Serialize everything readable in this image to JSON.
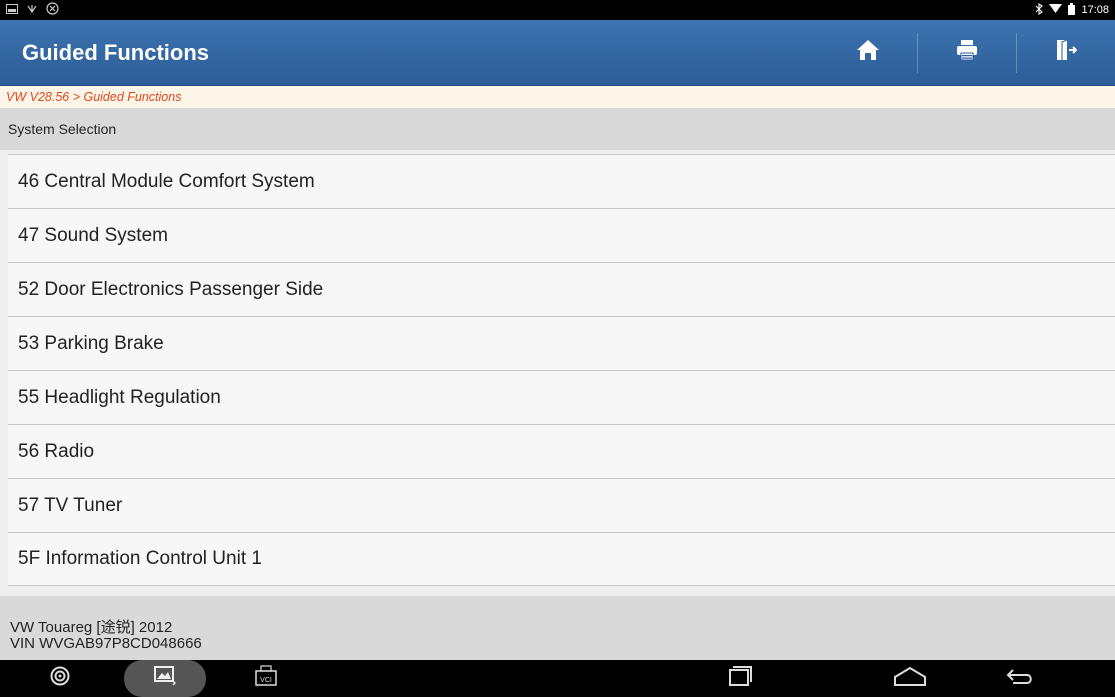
{
  "status_bar": {
    "time": "17:08",
    "left_icons": [
      "screenshot-icon",
      "usb-icon",
      "diagnostic-icon"
    ],
    "right_icons": [
      "bluetooth-icon",
      "wifi-icon",
      "battery-icon"
    ]
  },
  "header": {
    "title": "Guided Functions",
    "buttons": [
      "home-icon",
      "print-icon",
      "exit-icon"
    ],
    "color": "#3366a8"
  },
  "breadcrumb": "VW V28.56 > Guided Functions",
  "section_title": "System Selection",
  "systems": [
    "46 Central Module Comfort System",
    "47 Sound System",
    "52 Door Electronics Passenger Side",
    "53 Parking Brake",
    "55 Headlight Regulation",
    "56 Radio",
    "57 TV Tuner",
    "5F Information Control Unit 1"
  ],
  "vehicle": {
    "model": "VW Touareg [途锐] 2012",
    "vin": "VIN WVGAB97P8CD048666"
  },
  "nav_bar": {
    "icons": [
      "app-icon",
      "gallery-icon",
      "vci-icon",
      "recent-apps-icon",
      "home-nav-icon",
      "back-icon"
    ],
    "vci_label": "VCI"
  }
}
